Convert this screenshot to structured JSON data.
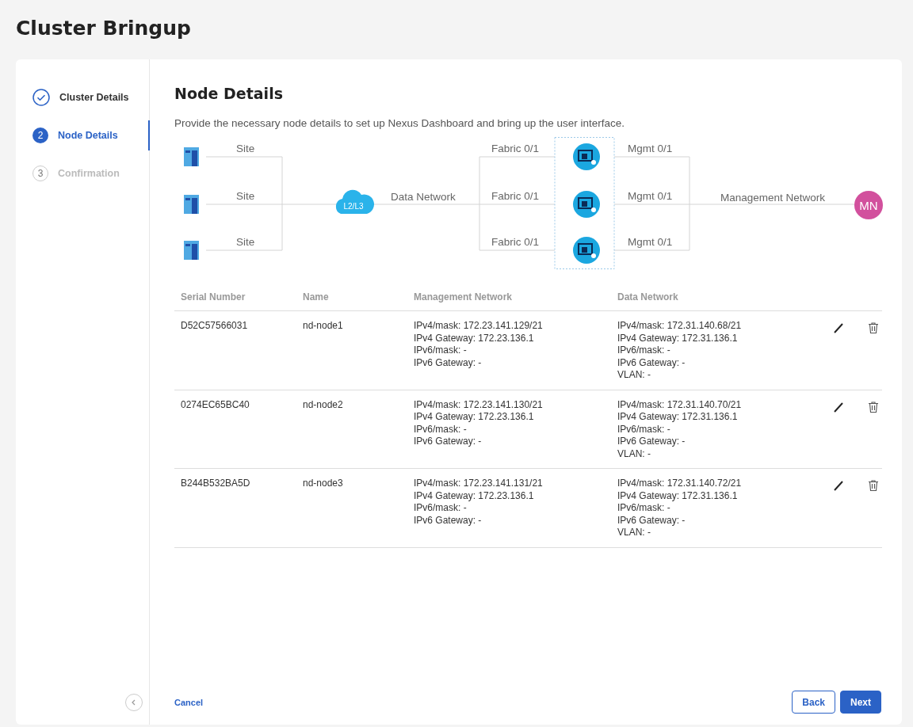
{
  "page_title": "Cluster Bringup",
  "steps": [
    {
      "label": "Cluster Details",
      "completed": true,
      "selected": false
    },
    {
      "number": "2",
      "label": "Node Details",
      "completed": false,
      "selected": true
    },
    {
      "number": "3",
      "label": "Confirmation",
      "completed": false,
      "selected": false
    }
  ],
  "heading": "Node Details",
  "description": "Provide the necessary node details to set up Nexus Dashboard and bring up the user interface.",
  "diagram": {
    "site_labels": [
      "Site",
      "Site",
      "Site"
    ],
    "cloud_label": "L2/L3",
    "data_network_label": "Data Network",
    "fabric_ports": [
      "Fabric 0/1",
      "Fabric 0/1",
      "Fabric 0/1"
    ],
    "mgmt_ports": [
      "Mgmt 0/1",
      "Mgmt 0/1",
      "Mgmt 0/1"
    ],
    "management_network_label": "Management Network",
    "mn_badge": "MN"
  },
  "table": {
    "columns": [
      "Serial Number",
      "Name",
      "Management Network",
      "Data Network"
    ],
    "rows": [
      {
        "serial": "D52C57566031",
        "name": "nd-node1",
        "management": [
          "IPv4/mask: 172.23.141.129/21",
          "IPv4 Gateway: 172.23.136.1",
          "IPv6/mask: -",
          "IPv6 Gateway: -"
        ],
        "data": [
          "IPv4/mask: 172.31.140.68/21",
          "IPv4 Gateway: 172.31.136.1",
          "IPv6/mask: -",
          "IPv6 Gateway: -",
          "VLAN: -"
        ]
      },
      {
        "serial": "0274EC65BC40",
        "name": "nd-node2",
        "management": [
          "IPv4/mask: 172.23.141.130/21",
          "IPv4 Gateway: 172.23.136.1",
          "IPv6/mask: -",
          "IPv6 Gateway: -"
        ],
        "data": [
          "IPv4/mask: 172.31.140.70/21",
          "IPv4 Gateway: 172.31.136.1",
          "IPv6/mask: -",
          "IPv6 Gateway: -",
          "VLAN: -"
        ]
      },
      {
        "serial": "B244B532BA5D",
        "name": "nd-node3",
        "management": [
          "IPv4/mask: 172.23.141.131/21",
          "IPv4 Gateway: 172.23.136.1",
          "IPv6/mask: -",
          "IPv6 Gateway: -"
        ],
        "data": [
          "IPv4/mask: 172.31.140.72/21",
          "IPv4 Gateway: 172.31.136.1",
          "IPv6/mask: -",
          "IPv6 Gateway: -",
          "VLAN: -"
        ]
      }
    ]
  },
  "footer": {
    "cancel": "Cancel",
    "back": "Back",
    "next": "Next"
  }
}
